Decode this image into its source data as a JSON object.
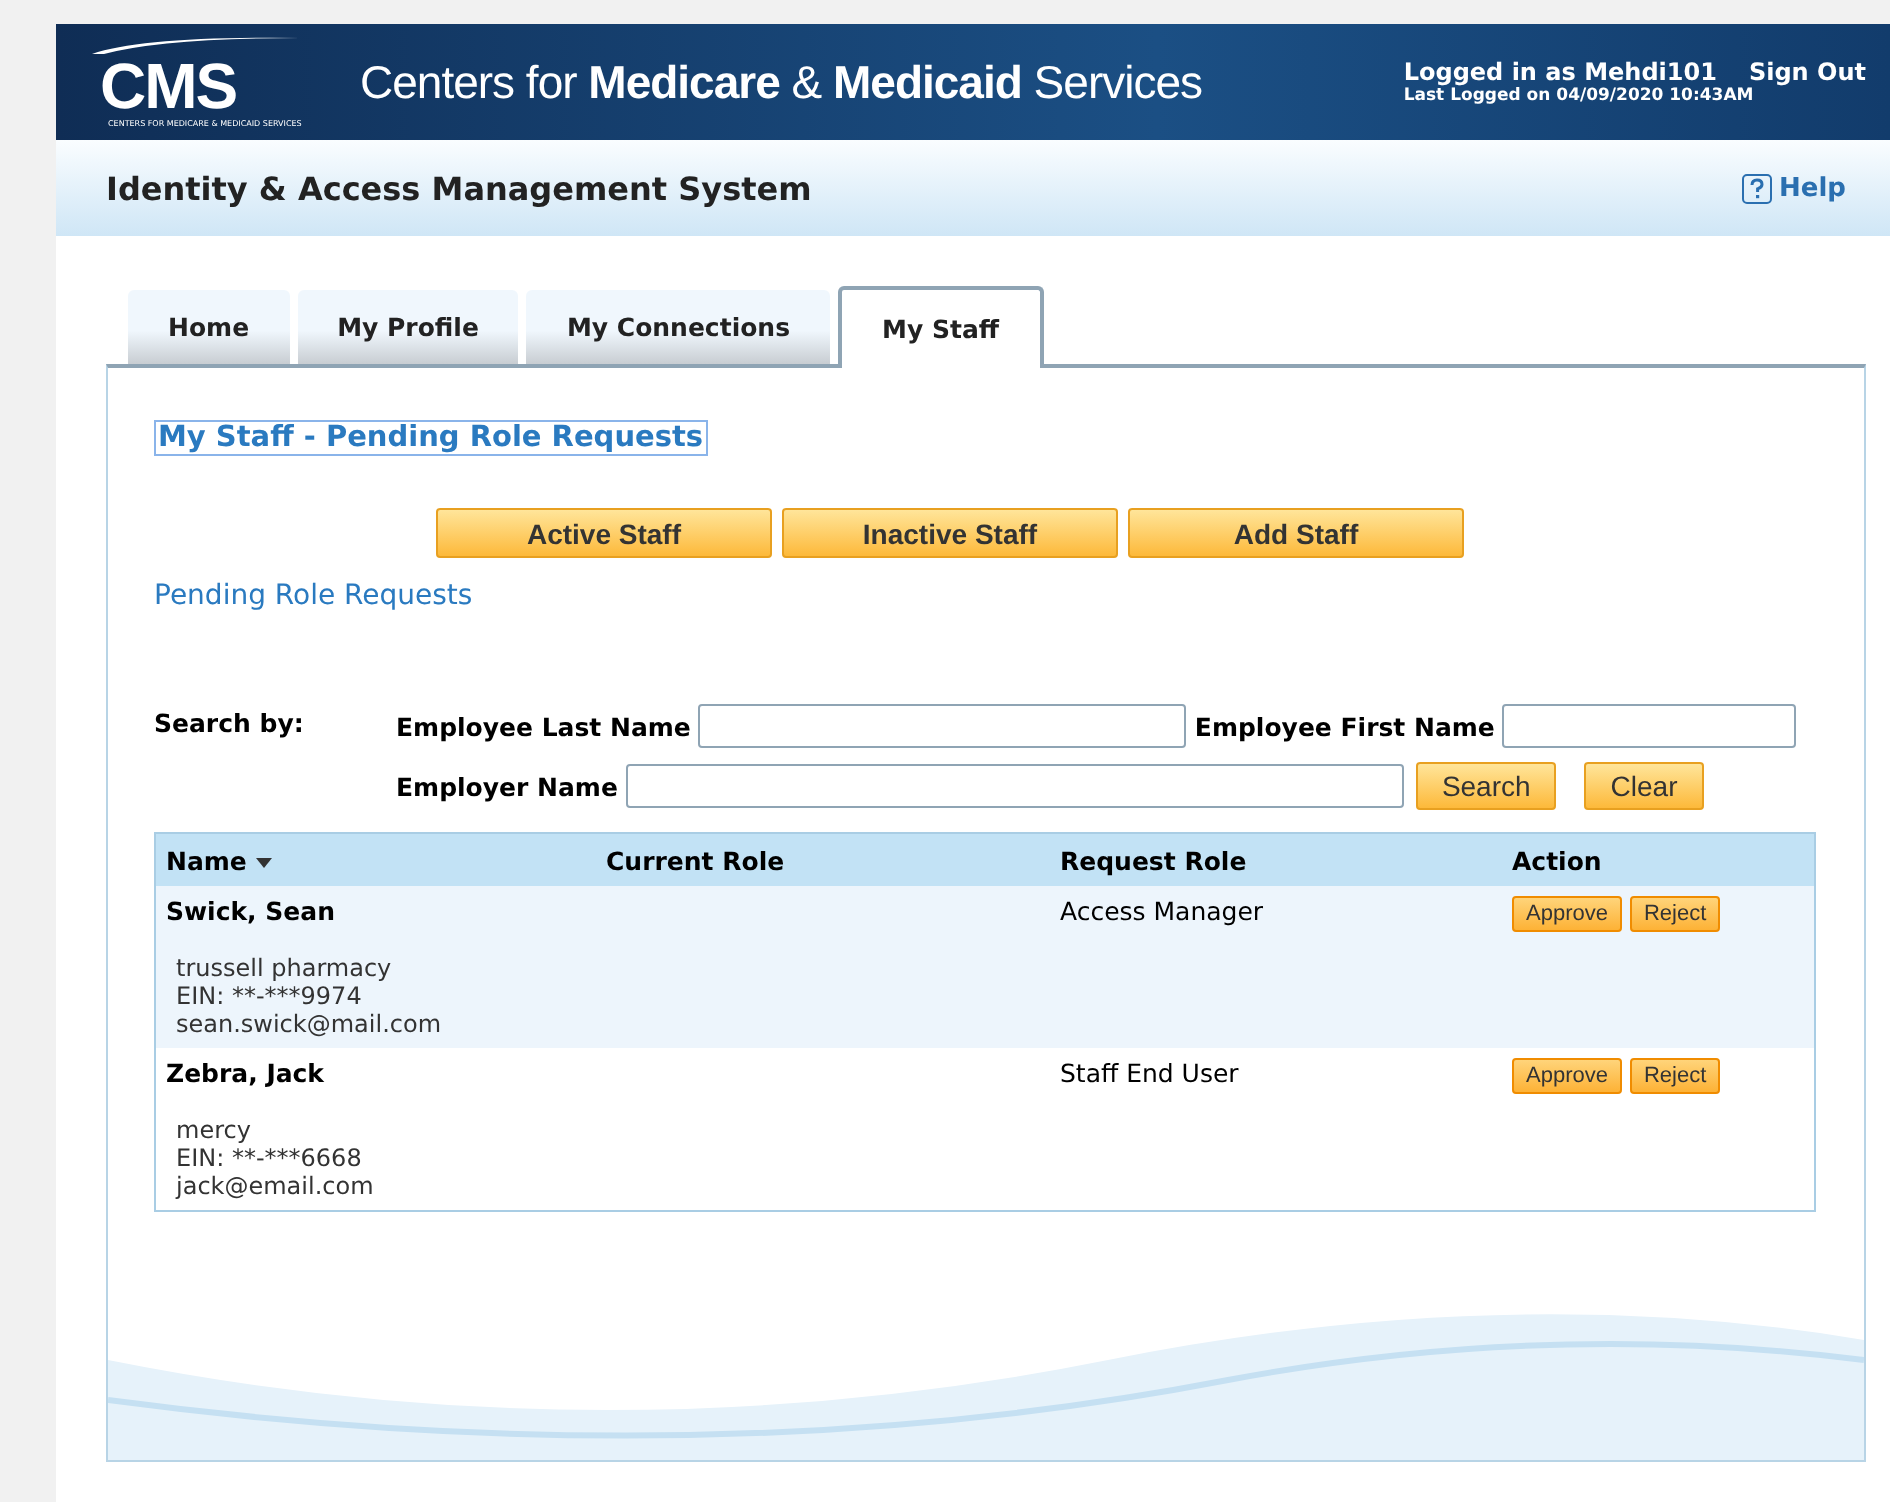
{
  "header": {
    "logo": "CMS",
    "logo_tagline": "CENTERS FOR MEDICARE & MEDICAID SERVICES",
    "agency": "Centers for **Medicare** & **Medicaid** Services",
    "user": "Logged in as Mehdi101",
    "sign_out": "Sign Out",
    "last_logged": "Last Logged on 04/09/2020 10:43AM"
  },
  "app_bar": {
    "title": "Identity & Access Management System",
    "help": "Help"
  },
  "tabs": [
    {
      "label": "Home",
      "selected": false
    },
    {
      "label": "My Profile",
      "selected": false
    },
    {
      "label": "My Connections",
      "selected": false
    },
    {
      "label": "My Staff",
      "selected": true
    }
  ],
  "page_title": "My Staff - Pending Role Requests",
  "staff_buttons": [
    "Active Staff",
    "Inactive Staff",
    "Add Staff"
  ],
  "section_label": "Pending Role Requests",
  "search": {
    "label": "Search by:",
    "last_name_label": "Employee Last Name",
    "first_name_label": "Employee First Name",
    "employer_label": "Employer Name",
    "search_button": "Search",
    "clear_button": "Clear"
  },
  "table": {
    "columns": [
      "Name",
      "Current Role",
      "Request Role",
      "Action"
    ],
    "rows": [
      {
        "name": "Swick, Sean",
        "details": [
          "trussell pharmacy",
          "EIN: **-***9974",
          "sean.swick@mail.com"
        ],
        "request_role": "Access Manager",
        "actions": [
          "Approve",
          "Reject"
        ]
      },
      {
        "name": "Zebra, Jack",
        "details": [
          "mercy",
          "EIN: **-***6668",
          "jack@email.com"
        ],
        "request_role": "Staff End User",
        "actions": [
          "Approve",
          "Reject"
        ]
      }
    ]
  }
}
